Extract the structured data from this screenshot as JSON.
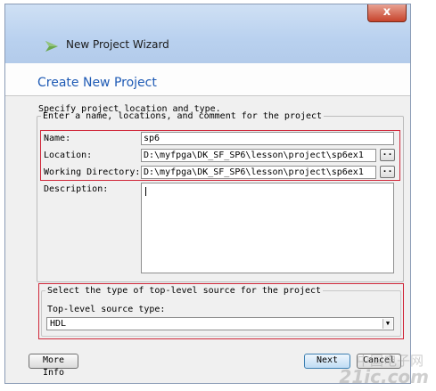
{
  "window": {
    "title": "New Project Wizard",
    "close_glyph": "x",
    "icon": "wizard-arrow-icon"
  },
  "header": {
    "title": "Create New Project"
  },
  "subtitle": "Specify project location and type.",
  "project_group": {
    "legend": "Enter a name, locations, and comment for the project",
    "name_label": "Name:",
    "name_value": "sp6",
    "location_label": "Location:",
    "location_value": "D:\\myfpga\\DK_SF_SP6\\lesson\\project\\sp6ex1",
    "workdir_label": "Working Directory:",
    "workdir_value": "D:\\myfpga\\DK_SF_SP6\\lesson\\project\\sp6ex1",
    "browse_label": "..",
    "description_label": "Description:",
    "description_value": ""
  },
  "source_group": {
    "legend": "Select the type of top-level source for the project",
    "type_label": "Top-level source type:",
    "type_value": "HDL"
  },
  "buttons": {
    "more_info": "More Info",
    "next": "Next",
    "cancel": "Cancel"
  },
  "watermark": {
    "text": "21ic.com",
    "cn": "中国电子网"
  },
  "colors": {
    "highlight": "#d0283a",
    "header_title": "#1f5bb5"
  }
}
